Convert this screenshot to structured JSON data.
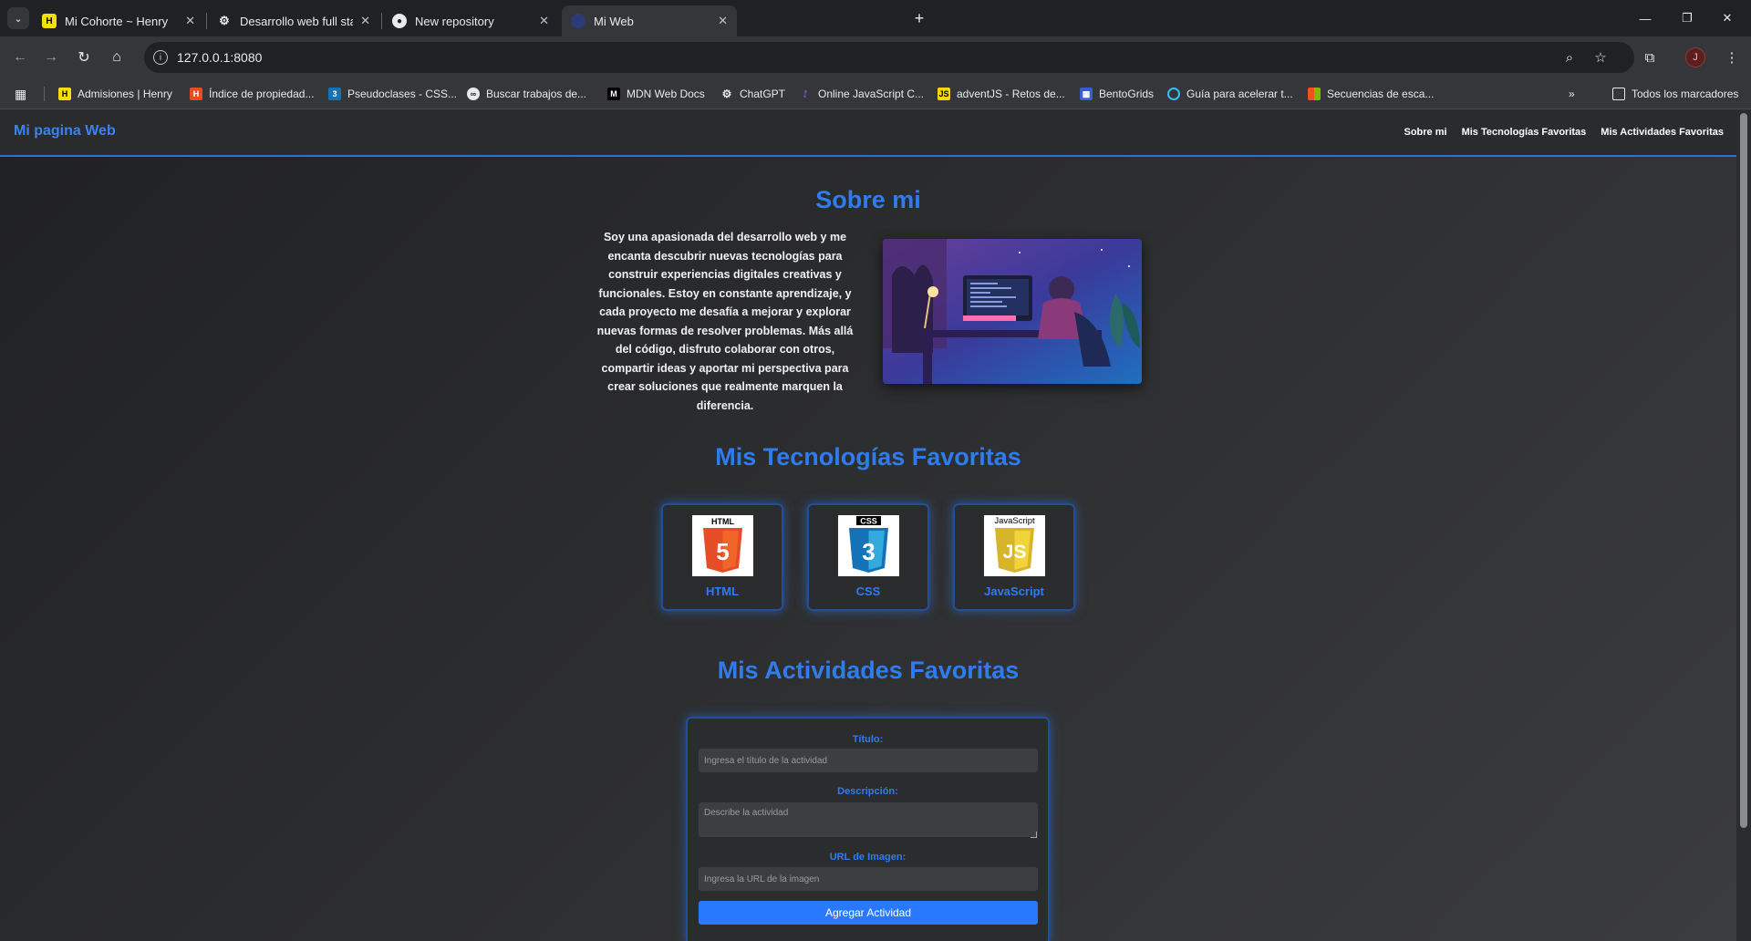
{
  "browser": {
    "tabs": [
      {
        "title": "Mi Cohorte ~ Henry",
        "favicon_color": "#f5e000"
      },
      {
        "title": "Desarrollo web full stack",
        "favicon_color": "#e8eaed"
      },
      {
        "title": "New repository",
        "favicon_color": "#e8eaed"
      },
      {
        "title": "Mi Web",
        "favicon_color": "#3b4a8a"
      }
    ],
    "url": "127.0.0.1:8080",
    "profile_initial": "J",
    "bookmarks": [
      "Admisiones | Henry",
      "Índice de propiedad...",
      "Pseudoclases - CSS...",
      "Buscar trabajos de...",
      "MDN Web Docs",
      "ChatGPT",
      "Online JavaScript C...",
      "adventJS - Retos de...",
      "BentoGrids",
      "Guía para acelerar t...",
      "Secuencias de esca..."
    ],
    "all_bookmarks": "Todos los marcadores"
  },
  "site": {
    "logo": "Mi pagina Web",
    "nav": [
      "Sobre mi",
      "Mis Tecnologías Favoritas",
      "Mis Actividades Favoritas"
    ],
    "about": {
      "heading": "Sobre mi",
      "text": "Soy una apasionada del desarrollo web y me encanta descubrir nuevas tecnologías para construir experiencias digitales creativas y funcionales. Estoy en constante aprendizaje, y cada proyecto me desafía a mejorar y explorar nuevas formas de resolver problemas. Más allá del código, disfruto colaborar con otros, compartir ideas y aportar mi perspectiva para crear soluciones que realmente marquen la diferencia."
    },
    "tech": {
      "heading": "Mis Tecnologías Favoritas",
      "items": [
        {
          "label": "HTML",
          "badge": "HTML",
          "digit": "5",
          "color": "#e44d26"
        },
        {
          "label": "CSS",
          "badge": "CSS",
          "digit": "3",
          "color": "#1572b6"
        },
        {
          "label": "JavaScript",
          "badge": "JavaScript",
          "digit": "JS",
          "color": "#e8c52a"
        }
      ]
    },
    "activities": {
      "heading": "Mis Actividades Favoritas",
      "title_label": "Título:",
      "title_placeholder": "Ingresa el título de la actividad",
      "desc_label": "Descripción:",
      "desc_placeholder": "Describe la actividad",
      "url_label": "URL de Imagen:",
      "url_placeholder": "Ingresa la URL de la imagen",
      "submit": "Agregar Actividad"
    },
    "accent": "#2f7cf0"
  }
}
